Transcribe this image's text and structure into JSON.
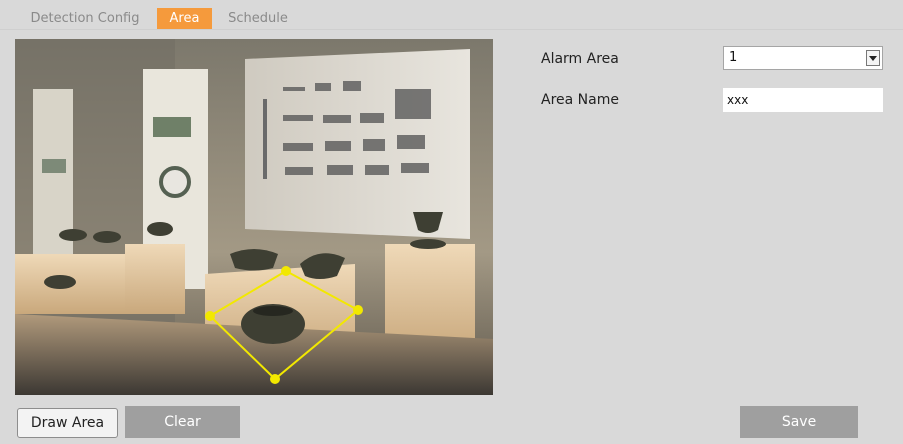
{
  "tabs": [
    {
      "label": "Detection Config"
    },
    {
      "label": "Area"
    },
    {
      "label": "Schedule"
    }
  ],
  "form": {
    "alarm_area_label": "Alarm Area",
    "alarm_area_value": "1",
    "area_name_label": "Area Name",
    "area_name_value": "xxx"
  },
  "buttons": {
    "draw_area": "Draw Area",
    "clear": "Clear",
    "save": "Save"
  },
  "colors": {
    "active_tab": "#f59a3c",
    "area_outline": "#f2e800",
    "button_gray": "#9f9f9f"
  }
}
